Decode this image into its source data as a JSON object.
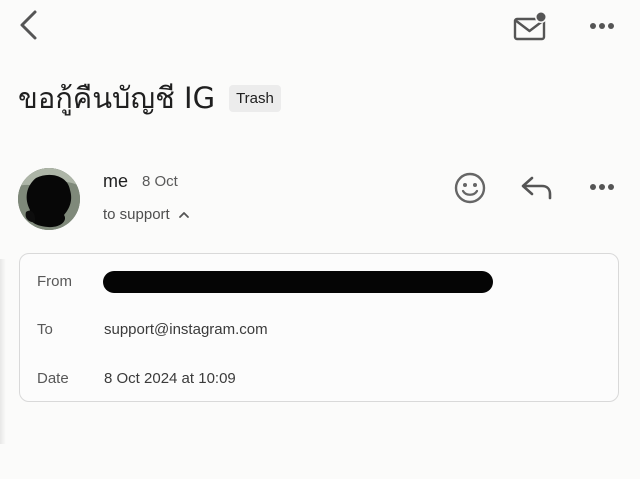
{
  "header": {
    "back_icon": "chevron-left-icon",
    "mail_icon": "mail-unread-icon",
    "more_icon": "more-horizontal-icon"
  },
  "email": {
    "subject": "ขอกู้คืนบัญชี IG",
    "folder_label": "Trash",
    "sender": "me",
    "date_short": "8 Oct",
    "recipient_summary": "to support",
    "actions": {
      "emoji_icon": "smiley-icon",
      "reply_icon": "reply-icon",
      "more_icon": "more-horizontal-icon"
    }
  },
  "details": {
    "from_label": "From",
    "to_label": "To",
    "to_value": "support@instagram.com",
    "date_label": "Date",
    "date_value": "8 Oct 2024 at 10:09"
  },
  "colors": {
    "background": "#fbfbfa",
    "text_primary": "#1f1f1f",
    "text_secondary": "#585858",
    "chip_background": "#ececec",
    "card_border": "#d9d9d9",
    "redaction": "#050505"
  }
}
